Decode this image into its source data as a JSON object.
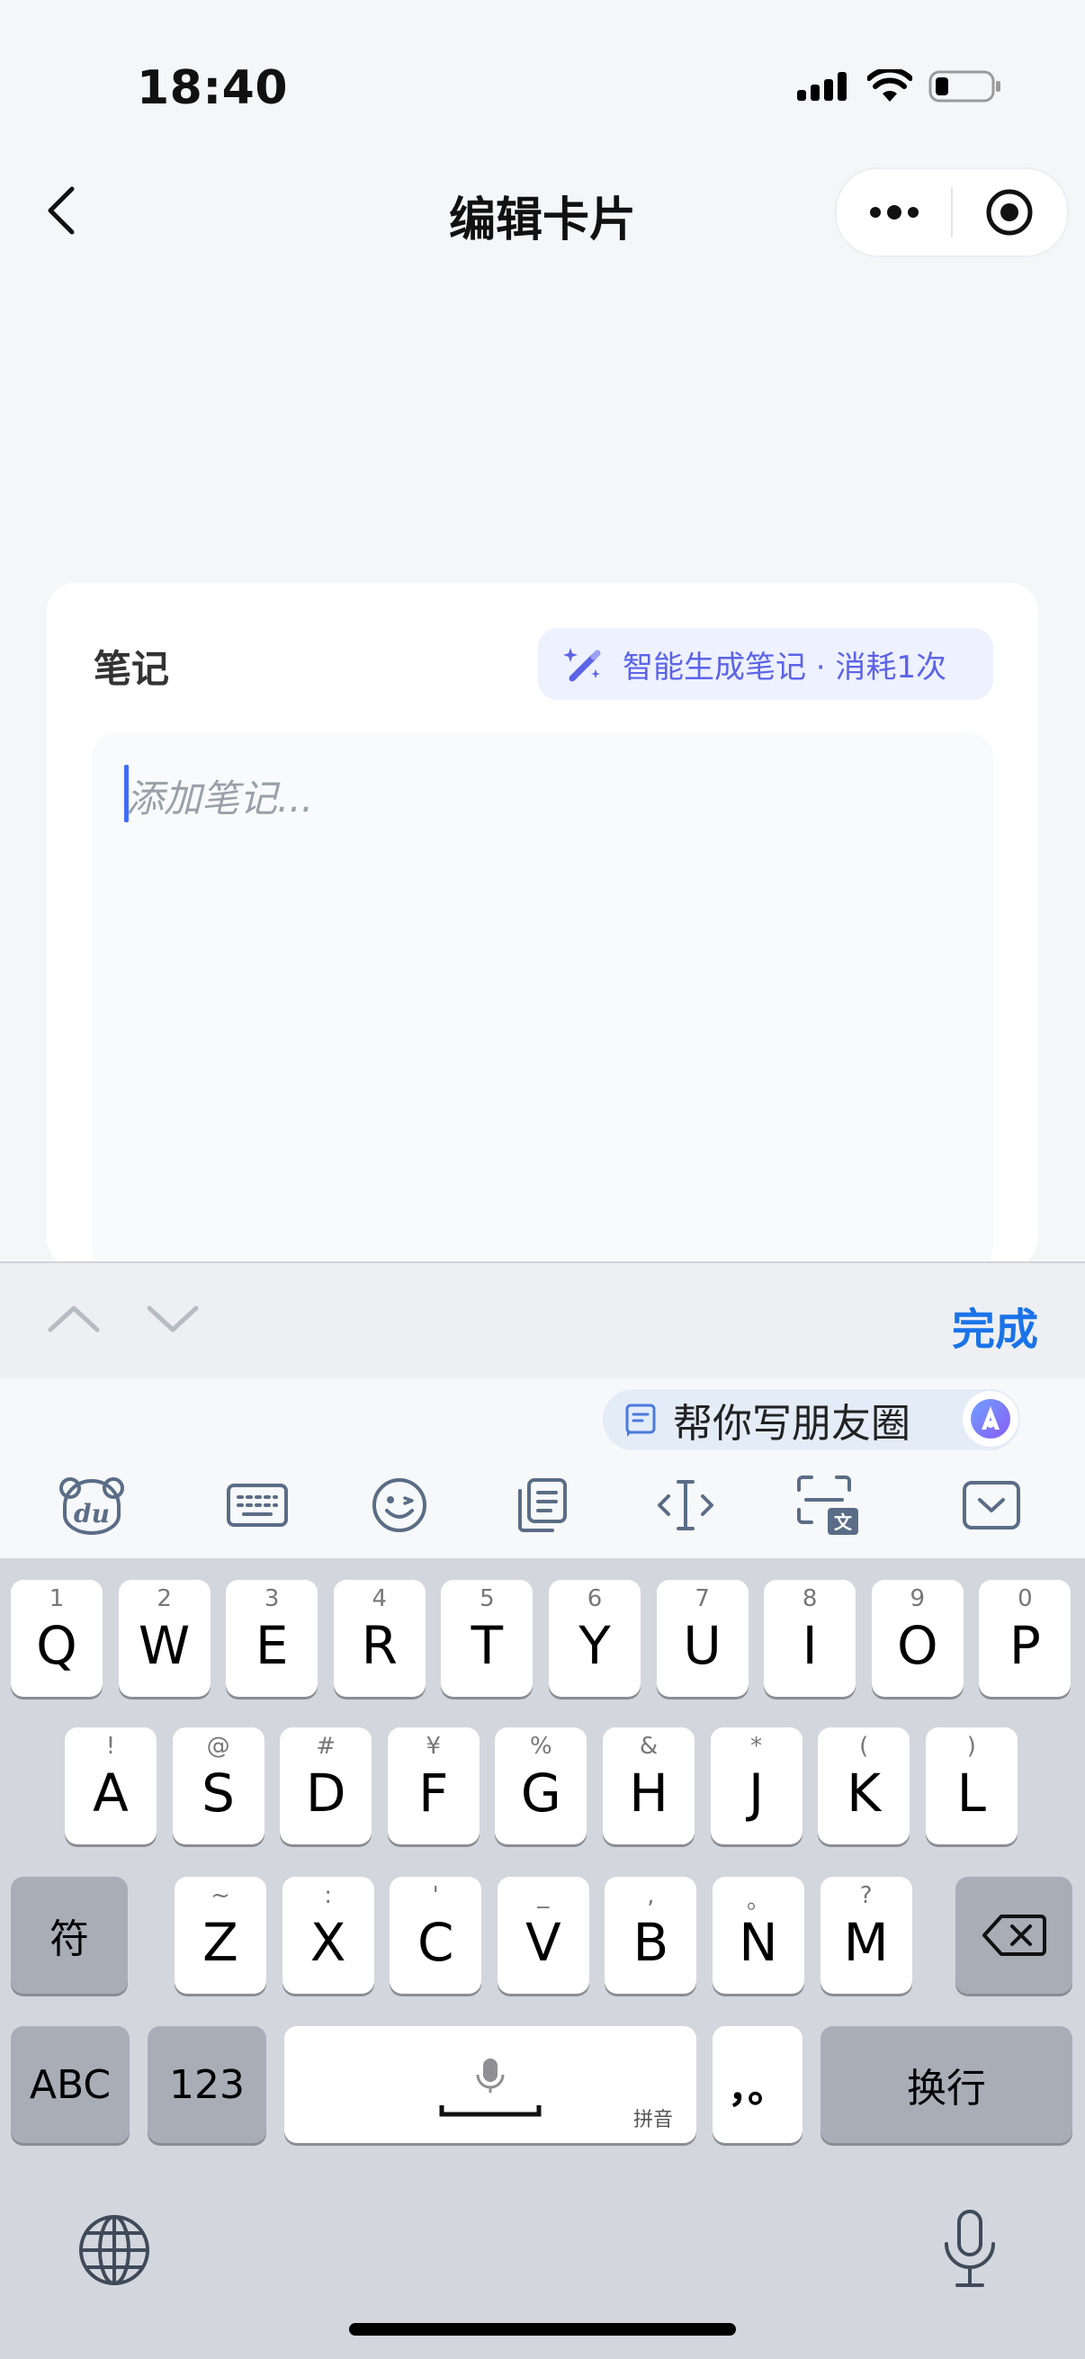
{
  "status_bar": {
    "time": "18:40"
  },
  "header": {
    "title": "编辑卡片"
  },
  "card": {
    "label": "笔记",
    "ai_button": "智能生成笔记 · 消耗1次",
    "placeholder": "添加笔记..."
  },
  "accessory": {
    "done": "完成"
  },
  "ime": {
    "suggestion": "帮你写朋友圈",
    "row1": [
      {
        "hint": "1",
        "key": "Q"
      },
      {
        "hint": "2",
        "key": "W"
      },
      {
        "hint": "3",
        "key": "E"
      },
      {
        "hint": "4",
        "key": "R"
      },
      {
        "hint": "5",
        "key": "T"
      },
      {
        "hint": "6",
        "key": "Y"
      },
      {
        "hint": "7",
        "key": "U"
      },
      {
        "hint": "8",
        "key": "I"
      },
      {
        "hint": "9",
        "key": "O"
      },
      {
        "hint": "0",
        "key": "P"
      }
    ],
    "row2": [
      {
        "hint": "!",
        "key": "A"
      },
      {
        "hint": "@",
        "key": "S"
      },
      {
        "hint": "#",
        "key": "D"
      },
      {
        "hint": "¥",
        "key": "F"
      },
      {
        "hint": "%",
        "key": "G"
      },
      {
        "hint": "&",
        "key": "H"
      },
      {
        "hint": "*",
        "key": "J"
      },
      {
        "hint": "(",
        "key": "K"
      },
      {
        "hint": ")",
        "key": "L"
      }
    ],
    "row3": [
      {
        "hint": "~",
        "key": "Z"
      },
      {
        "hint": ":",
        "key": "X"
      },
      {
        "hint": "'",
        "key": "C"
      },
      {
        "hint": "_",
        "key": "V"
      },
      {
        "hint": ",",
        "key": "B"
      },
      {
        "hint": "。",
        "key": "N"
      },
      {
        "hint": "?",
        "key": "M"
      }
    ],
    "symbol_key": "符",
    "abc_key": "ABC",
    "num_key": "123",
    "space_label": "拼音",
    "punct_key": "，。",
    "return_key": "换行"
  }
}
